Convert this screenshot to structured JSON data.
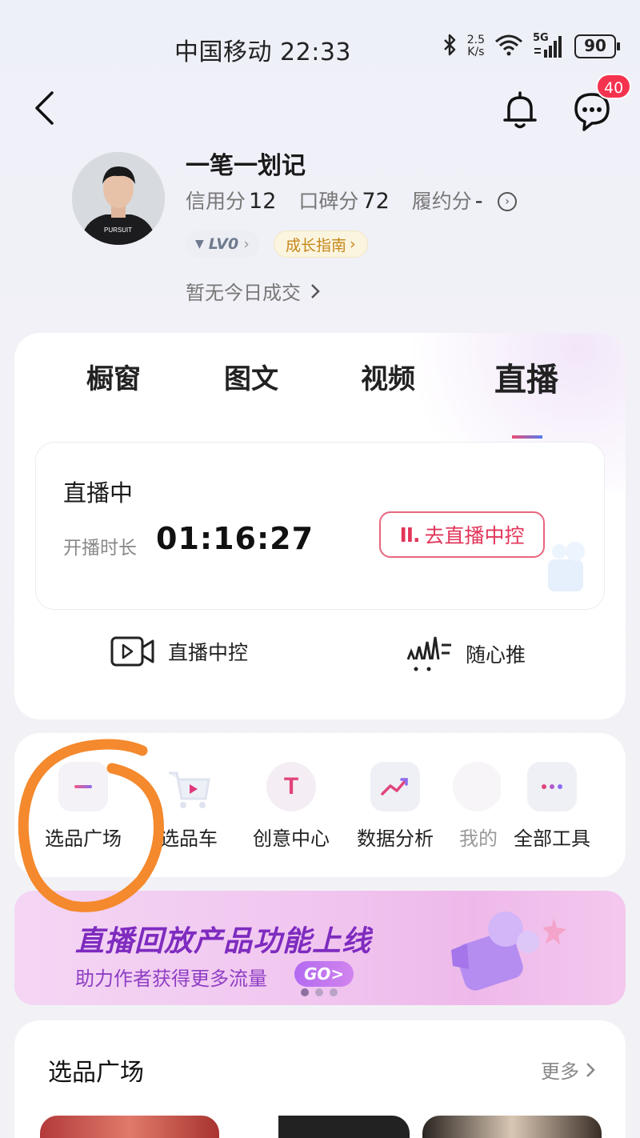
{
  "status_bar": {
    "carrier_time": "中国移动 22:33",
    "net_speed_value": "2.5",
    "net_speed_unit": "K/s",
    "network": "5G",
    "battery": "90"
  },
  "header": {
    "message_badge": "40"
  },
  "profile": {
    "name": "一笔一划记",
    "credit_label": "信用分",
    "credit_value": "12",
    "reputation_label": "口碑分",
    "reputation_value": "72",
    "fulfillment_label": "履约分",
    "fulfillment_value": "-",
    "level": "LV0",
    "growth_guide": "成长指南",
    "no_deal_today": "暂无今日成交"
  },
  "tabs": [
    {
      "label": "橱窗"
    },
    {
      "label": "图文"
    },
    {
      "label": "视频"
    },
    {
      "label": "直播"
    }
  ],
  "live": {
    "status": "直播中",
    "duration_label": "开播时长",
    "duration_value": "01:16:27",
    "goto_control_label": "去直播中控"
  },
  "quick_actions": [
    {
      "label": "直播中控",
      "icon": "video-camera-icon"
    },
    {
      "label": "随心推",
      "icon": "promote-chart-icon"
    }
  ],
  "tools": [
    {
      "label": "选品广场",
      "icon": "product-square-icon"
    },
    {
      "label": "选品车",
      "icon": "shopping-cart-icon"
    },
    {
      "label": "创意中心",
      "icon": "creative-center-icon"
    },
    {
      "label": "数据分析",
      "icon": "data-analysis-icon"
    },
    {
      "label": "我的",
      "icon": "my-icon"
    },
    {
      "label": "全部工具",
      "icon": "all-tools-icon"
    }
  ],
  "banner": {
    "title": "直播回放产品功能上线",
    "subtitle": "助力作者获得更多流量",
    "go_label": "GO>"
  },
  "product_section": {
    "title": "选品广场",
    "more_label": "更多"
  },
  "colors": {
    "accent_red": "#f5334f",
    "control_pink": "#e2355a",
    "growth_gold": "#c5871a",
    "banner_purple": "#7e2bbf",
    "annotation_orange": "#f4892d"
  }
}
